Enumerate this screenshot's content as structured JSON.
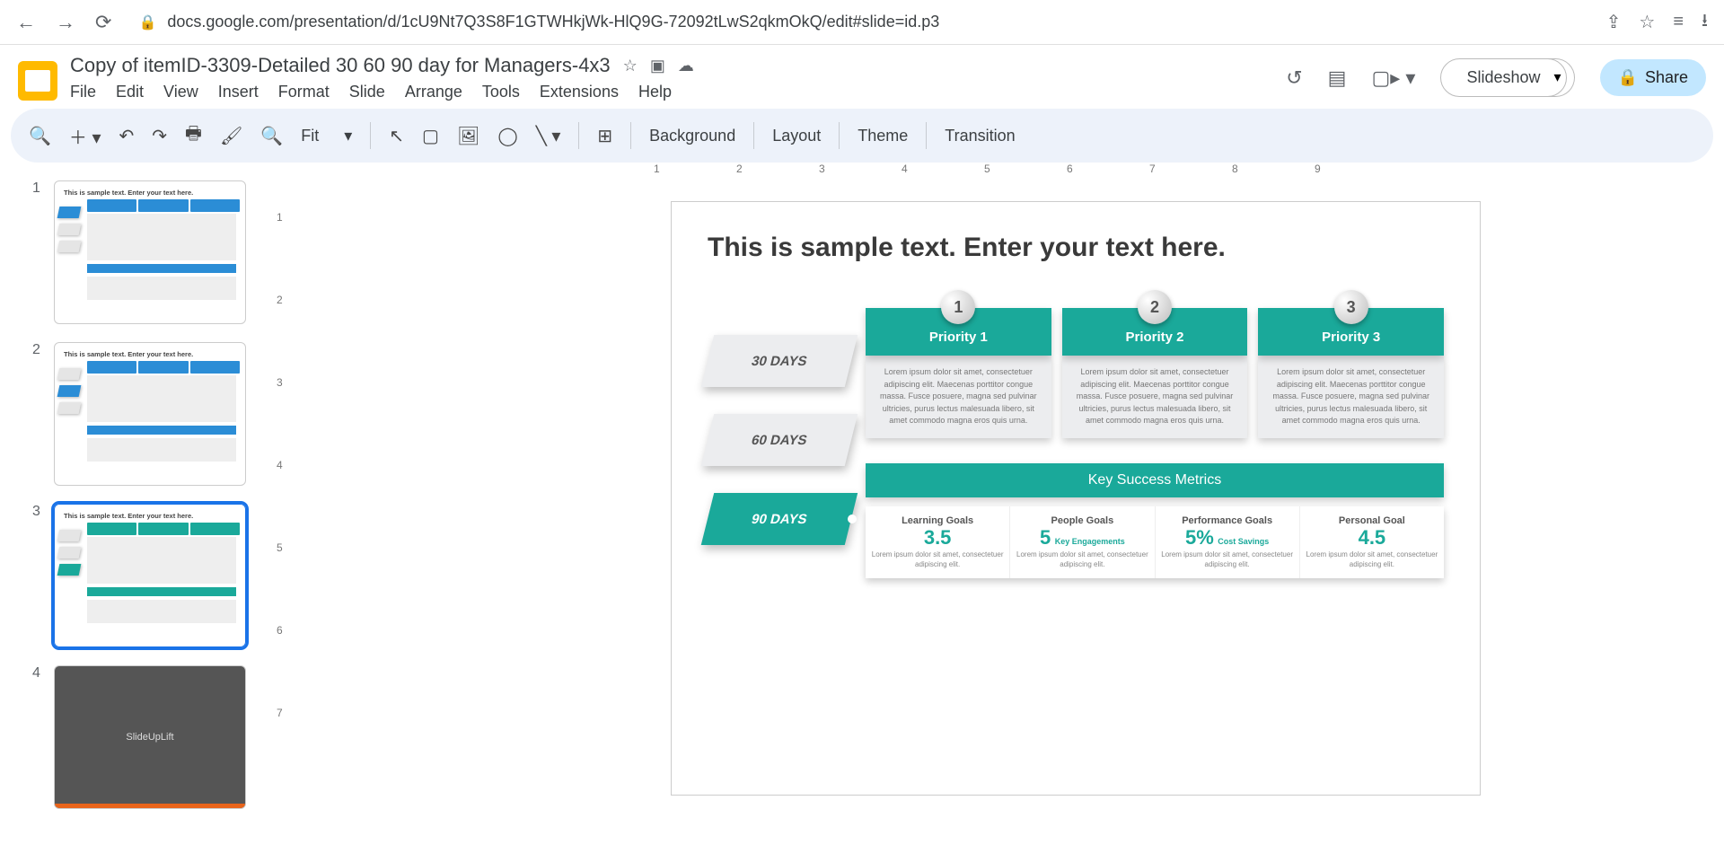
{
  "url": "docs.google.com/presentation/d/1cU9Nt7Q3S8F1GTWHkjWk-HlQ9G-72092tLwS2qkmOkQ/edit#slide=id.p3",
  "doc_title": "Copy of itemID-3309-Detailed 30 60 90 day for Managers-4x3",
  "menus": [
    "File",
    "Edit",
    "View",
    "Insert",
    "Format",
    "Slide",
    "Arrange",
    "Tools",
    "Extensions",
    "Help"
  ],
  "toolbar": {
    "fit": "Fit",
    "background": "Background",
    "layout": "Layout",
    "theme": "Theme",
    "transition": "Transition"
  },
  "slideshow": "Slideshow",
  "share": "Share",
  "thumbs": {
    "title": "This is sample text. Enter your text here.",
    "brand": "SlideUpLift"
  },
  "slide": {
    "title": "This is sample text. Enter your text here.",
    "days": [
      "30 DAYS",
      "60 DAYS",
      "90 DAYS"
    ],
    "priorities": [
      {
        "num": "1",
        "label": "Priority 1"
      },
      {
        "num": "2",
        "label": "Priority 2"
      },
      {
        "num": "3",
        "label": "Priority 3"
      }
    ],
    "lorem": "Lorem ipsum dolor sit amet, consectetuer adipiscing elit. Maecenas porttitor congue massa. Fusce posuere, magna sed pulvinar ultricies, purus lectus malesuada libero, sit amet commodo magna eros quis urna.",
    "metrics_hd": "Key Success Metrics",
    "metrics": [
      {
        "title": "Learning Goals",
        "val": "3.5",
        "sub": "",
        "desc": "Lorem ipsum dolor sit amet, consectetuer adipiscing elit."
      },
      {
        "title": "People Goals",
        "val": "5",
        "sub": "Key Engagements",
        "desc": "Lorem ipsum dolor sit amet, consectetuer adipiscing elit."
      },
      {
        "title": "Performance Goals",
        "val": "5%",
        "sub": "Cost Savings",
        "desc": "Lorem ipsum dolor sit amet, consectetuer adipiscing elit."
      },
      {
        "title": "Personal Goal",
        "val": "4.5",
        "sub": "",
        "desc": "Lorem ipsum dolor sit amet, consectetuer adipiscing elit."
      }
    ]
  },
  "ruler_h": [
    1,
    2,
    3,
    4,
    5,
    6,
    7,
    8,
    9
  ],
  "ruler_v": [
    1,
    2,
    3,
    4,
    5,
    6,
    7
  ]
}
